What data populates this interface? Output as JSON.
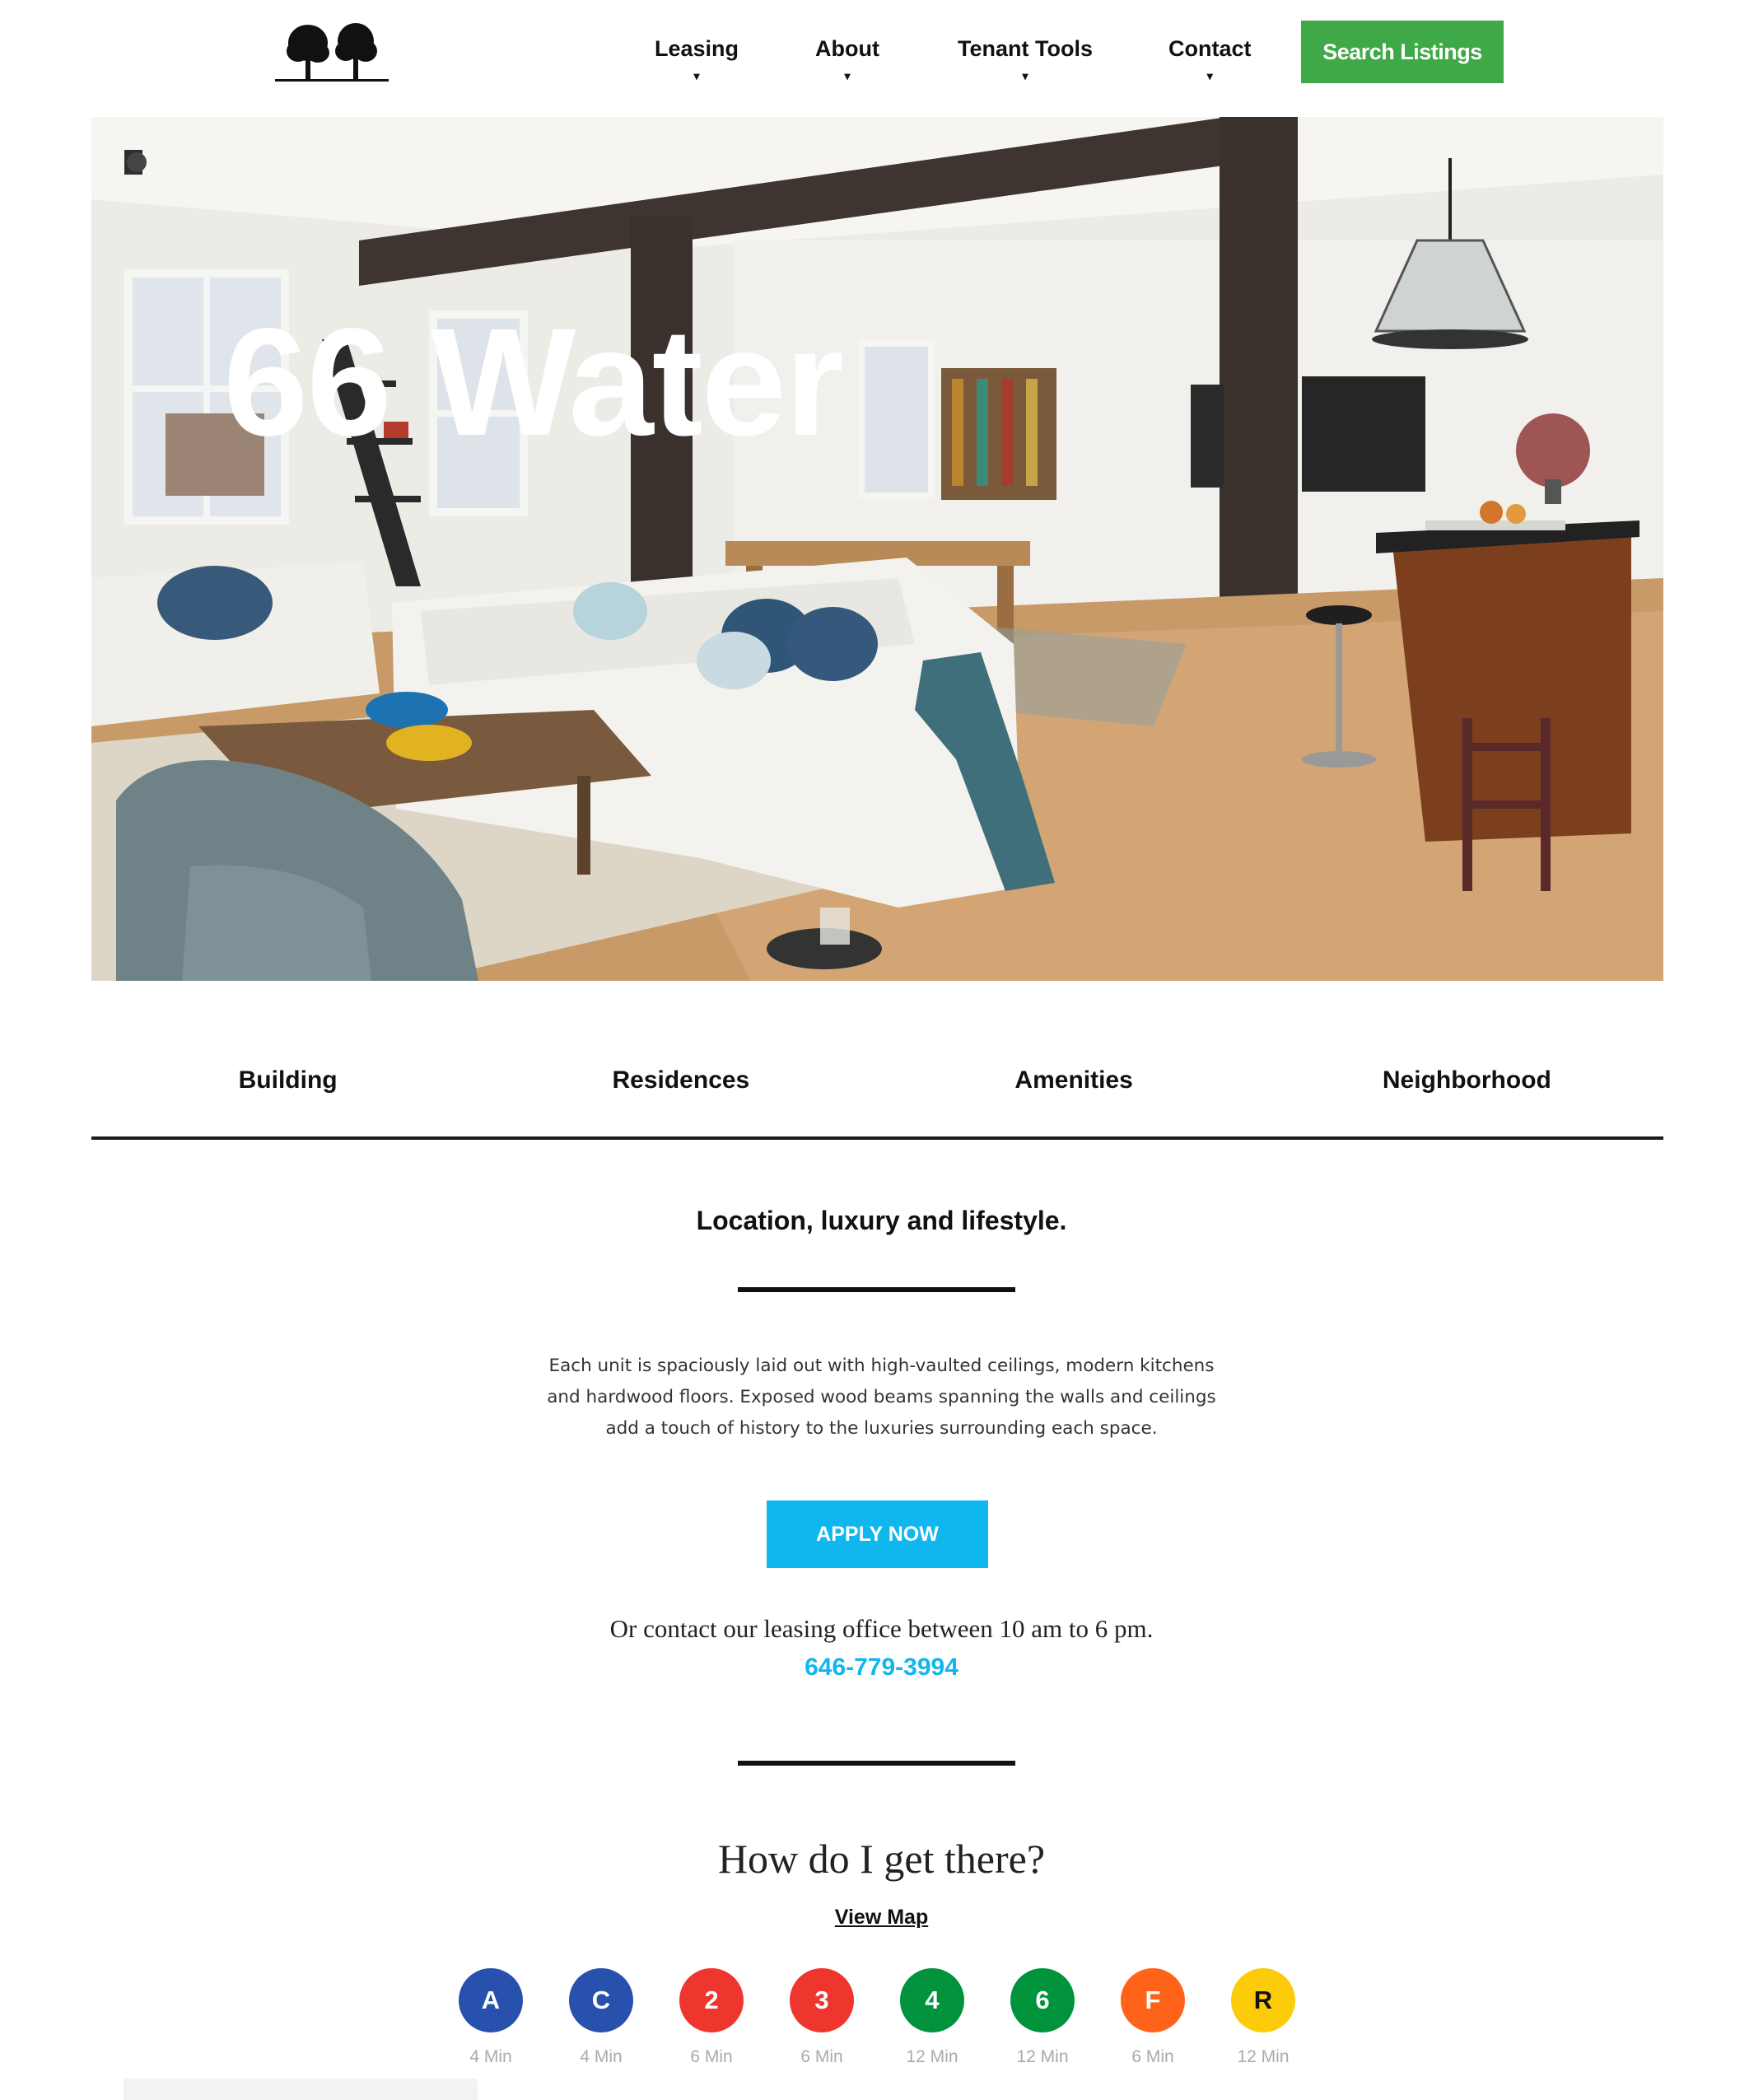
{
  "header": {
    "logo": "two-trees-logo",
    "nav": [
      {
        "label": "Leasing",
        "caret": "▾"
      },
      {
        "label": "About",
        "caret": "▾"
      },
      {
        "label": "Tenant Tools",
        "caret": "▾"
      },
      {
        "label": "Contact",
        "caret": "▾"
      }
    ],
    "search_label": "Search Listings",
    "search_color": "#3fa947"
  },
  "hero": {
    "title": "66 Water",
    "image": "loft-living-room-photo"
  },
  "tabs": [
    "Building",
    "Residences",
    "Amenities",
    "Neighborhood"
  ],
  "intro": {
    "tagline": "Location, luxury and lifestyle.",
    "description": [
      "Each unit is spaciously laid out with high-vaulted ceilings, modern kitchens",
      "and hardwood floors. Exposed wood beams spanning the walls and ceilings",
      "add a touch of history to the luxuries surrounding each space."
    ],
    "apply_label": "APPLY NOW",
    "apply_color": "#10b7ef",
    "contact_text": "Or contact our leasing office between 10 am to 6 pm.",
    "phone": "646-779-3994"
  },
  "transit": {
    "heading": "How do I get there?",
    "map_link": "View Map",
    "trains": [
      {
        "line": "A",
        "time": "4 Min",
        "color": "#2850ad"
      },
      {
        "line": "C",
        "time": "4 Min",
        "color": "#2850ad"
      },
      {
        "line": "2",
        "time": "6 Min",
        "color": "#ee352e"
      },
      {
        "line": "3",
        "time": "6 Min",
        "color": "#ee352e"
      },
      {
        "line": "4",
        "time": "12 Min",
        "color": "#00933c"
      },
      {
        "line": "6",
        "time": "12 Min",
        "color": "#00933c"
      },
      {
        "line": "F",
        "time": "6 Min",
        "color": "#ff6319"
      },
      {
        "line": "R",
        "time": "12 Min",
        "color": "#fccc0a"
      }
    ]
  }
}
